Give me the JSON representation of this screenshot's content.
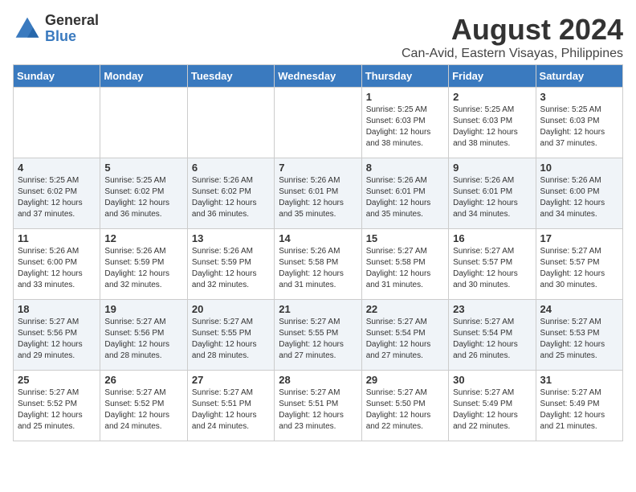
{
  "logo": {
    "general": "General",
    "blue": "Blue"
  },
  "title": "August 2024",
  "subtitle": "Can-Avid, Eastern Visayas, Philippines",
  "days_of_week": [
    "Sunday",
    "Monday",
    "Tuesday",
    "Wednesday",
    "Thursday",
    "Friday",
    "Saturday"
  ],
  "weeks": [
    [
      {
        "day": "",
        "info": ""
      },
      {
        "day": "",
        "info": ""
      },
      {
        "day": "",
        "info": ""
      },
      {
        "day": "",
        "info": ""
      },
      {
        "day": "1",
        "info": "Sunrise: 5:25 AM\nSunset: 6:03 PM\nDaylight: 12 hours and 38 minutes."
      },
      {
        "day": "2",
        "info": "Sunrise: 5:25 AM\nSunset: 6:03 PM\nDaylight: 12 hours and 38 minutes."
      },
      {
        "day": "3",
        "info": "Sunrise: 5:25 AM\nSunset: 6:03 PM\nDaylight: 12 hours and 37 minutes."
      }
    ],
    [
      {
        "day": "4",
        "info": "Sunrise: 5:25 AM\nSunset: 6:02 PM\nDaylight: 12 hours and 37 minutes."
      },
      {
        "day": "5",
        "info": "Sunrise: 5:25 AM\nSunset: 6:02 PM\nDaylight: 12 hours and 36 minutes."
      },
      {
        "day": "6",
        "info": "Sunrise: 5:26 AM\nSunset: 6:02 PM\nDaylight: 12 hours and 36 minutes."
      },
      {
        "day": "7",
        "info": "Sunrise: 5:26 AM\nSunset: 6:01 PM\nDaylight: 12 hours and 35 minutes."
      },
      {
        "day": "8",
        "info": "Sunrise: 5:26 AM\nSunset: 6:01 PM\nDaylight: 12 hours and 35 minutes."
      },
      {
        "day": "9",
        "info": "Sunrise: 5:26 AM\nSunset: 6:01 PM\nDaylight: 12 hours and 34 minutes."
      },
      {
        "day": "10",
        "info": "Sunrise: 5:26 AM\nSunset: 6:00 PM\nDaylight: 12 hours and 34 minutes."
      }
    ],
    [
      {
        "day": "11",
        "info": "Sunrise: 5:26 AM\nSunset: 6:00 PM\nDaylight: 12 hours and 33 minutes."
      },
      {
        "day": "12",
        "info": "Sunrise: 5:26 AM\nSunset: 5:59 PM\nDaylight: 12 hours and 32 minutes."
      },
      {
        "day": "13",
        "info": "Sunrise: 5:26 AM\nSunset: 5:59 PM\nDaylight: 12 hours and 32 minutes."
      },
      {
        "day": "14",
        "info": "Sunrise: 5:26 AM\nSunset: 5:58 PM\nDaylight: 12 hours and 31 minutes."
      },
      {
        "day": "15",
        "info": "Sunrise: 5:27 AM\nSunset: 5:58 PM\nDaylight: 12 hours and 31 minutes."
      },
      {
        "day": "16",
        "info": "Sunrise: 5:27 AM\nSunset: 5:57 PM\nDaylight: 12 hours and 30 minutes."
      },
      {
        "day": "17",
        "info": "Sunrise: 5:27 AM\nSunset: 5:57 PM\nDaylight: 12 hours and 30 minutes."
      }
    ],
    [
      {
        "day": "18",
        "info": "Sunrise: 5:27 AM\nSunset: 5:56 PM\nDaylight: 12 hours and 29 minutes."
      },
      {
        "day": "19",
        "info": "Sunrise: 5:27 AM\nSunset: 5:56 PM\nDaylight: 12 hours and 28 minutes."
      },
      {
        "day": "20",
        "info": "Sunrise: 5:27 AM\nSunset: 5:55 PM\nDaylight: 12 hours and 28 minutes."
      },
      {
        "day": "21",
        "info": "Sunrise: 5:27 AM\nSunset: 5:55 PM\nDaylight: 12 hours and 27 minutes."
      },
      {
        "day": "22",
        "info": "Sunrise: 5:27 AM\nSunset: 5:54 PM\nDaylight: 12 hours and 27 minutes."
      },
      {
        "day": "23",
        "info": "Sunrise: 5:27 AM\nSunset: 5:54 PM\nDaylight: 12 hours and 26 minutes."
      },
      {
        "day": "24",
        "info": "Sunrise: 5:27 AM\nSunset: 5:53 PM\nDaylight: 12 hours and 25 minutes."
      }
    ],
    [
      {
        "day": "25",
        "info": "Sunrise: 5:27 AM\nSunset: 5:52 PM\nDaylight: 12 hours and 25 minutes."
      },
      {
        "day": "26",
        "info": "Sunrise: 5:27 AM\nSunset: 5:52 PM\nDaylight: 12 hours and 24 minutes."
      },
      {
        "day": "27",
        "info": "Sunrise: 5:27 AM\nSunset: 5:51 PM\nDaylight: 12 hours and 24 minutes."
      },
      {
        "day": "28",
        "info": "Sunrise: 5:27 AM\nSunset: 5:51 PM\nDaylight: 12 hours and 23 minutes."
      },
      {
        "day": "29",
        "info": "Sunrise: 5:27 AM\nSunset: 5:50 PM\nDaylight: 12 hours and 22 minutes."
      },
      {
        "day": "30",
        "info": "Sunrise: 5:27 AM\nSunset: 5:49 PM\nDaylight: 12 hours and 22 minutes."
      },
      {
        "day": "31",
        "info": "Sunrise: 5:27 AM\nSunset: 5:49 PM\nDaylight: 12 hours and 21 minutes."
      }
    ]
  ]
}
